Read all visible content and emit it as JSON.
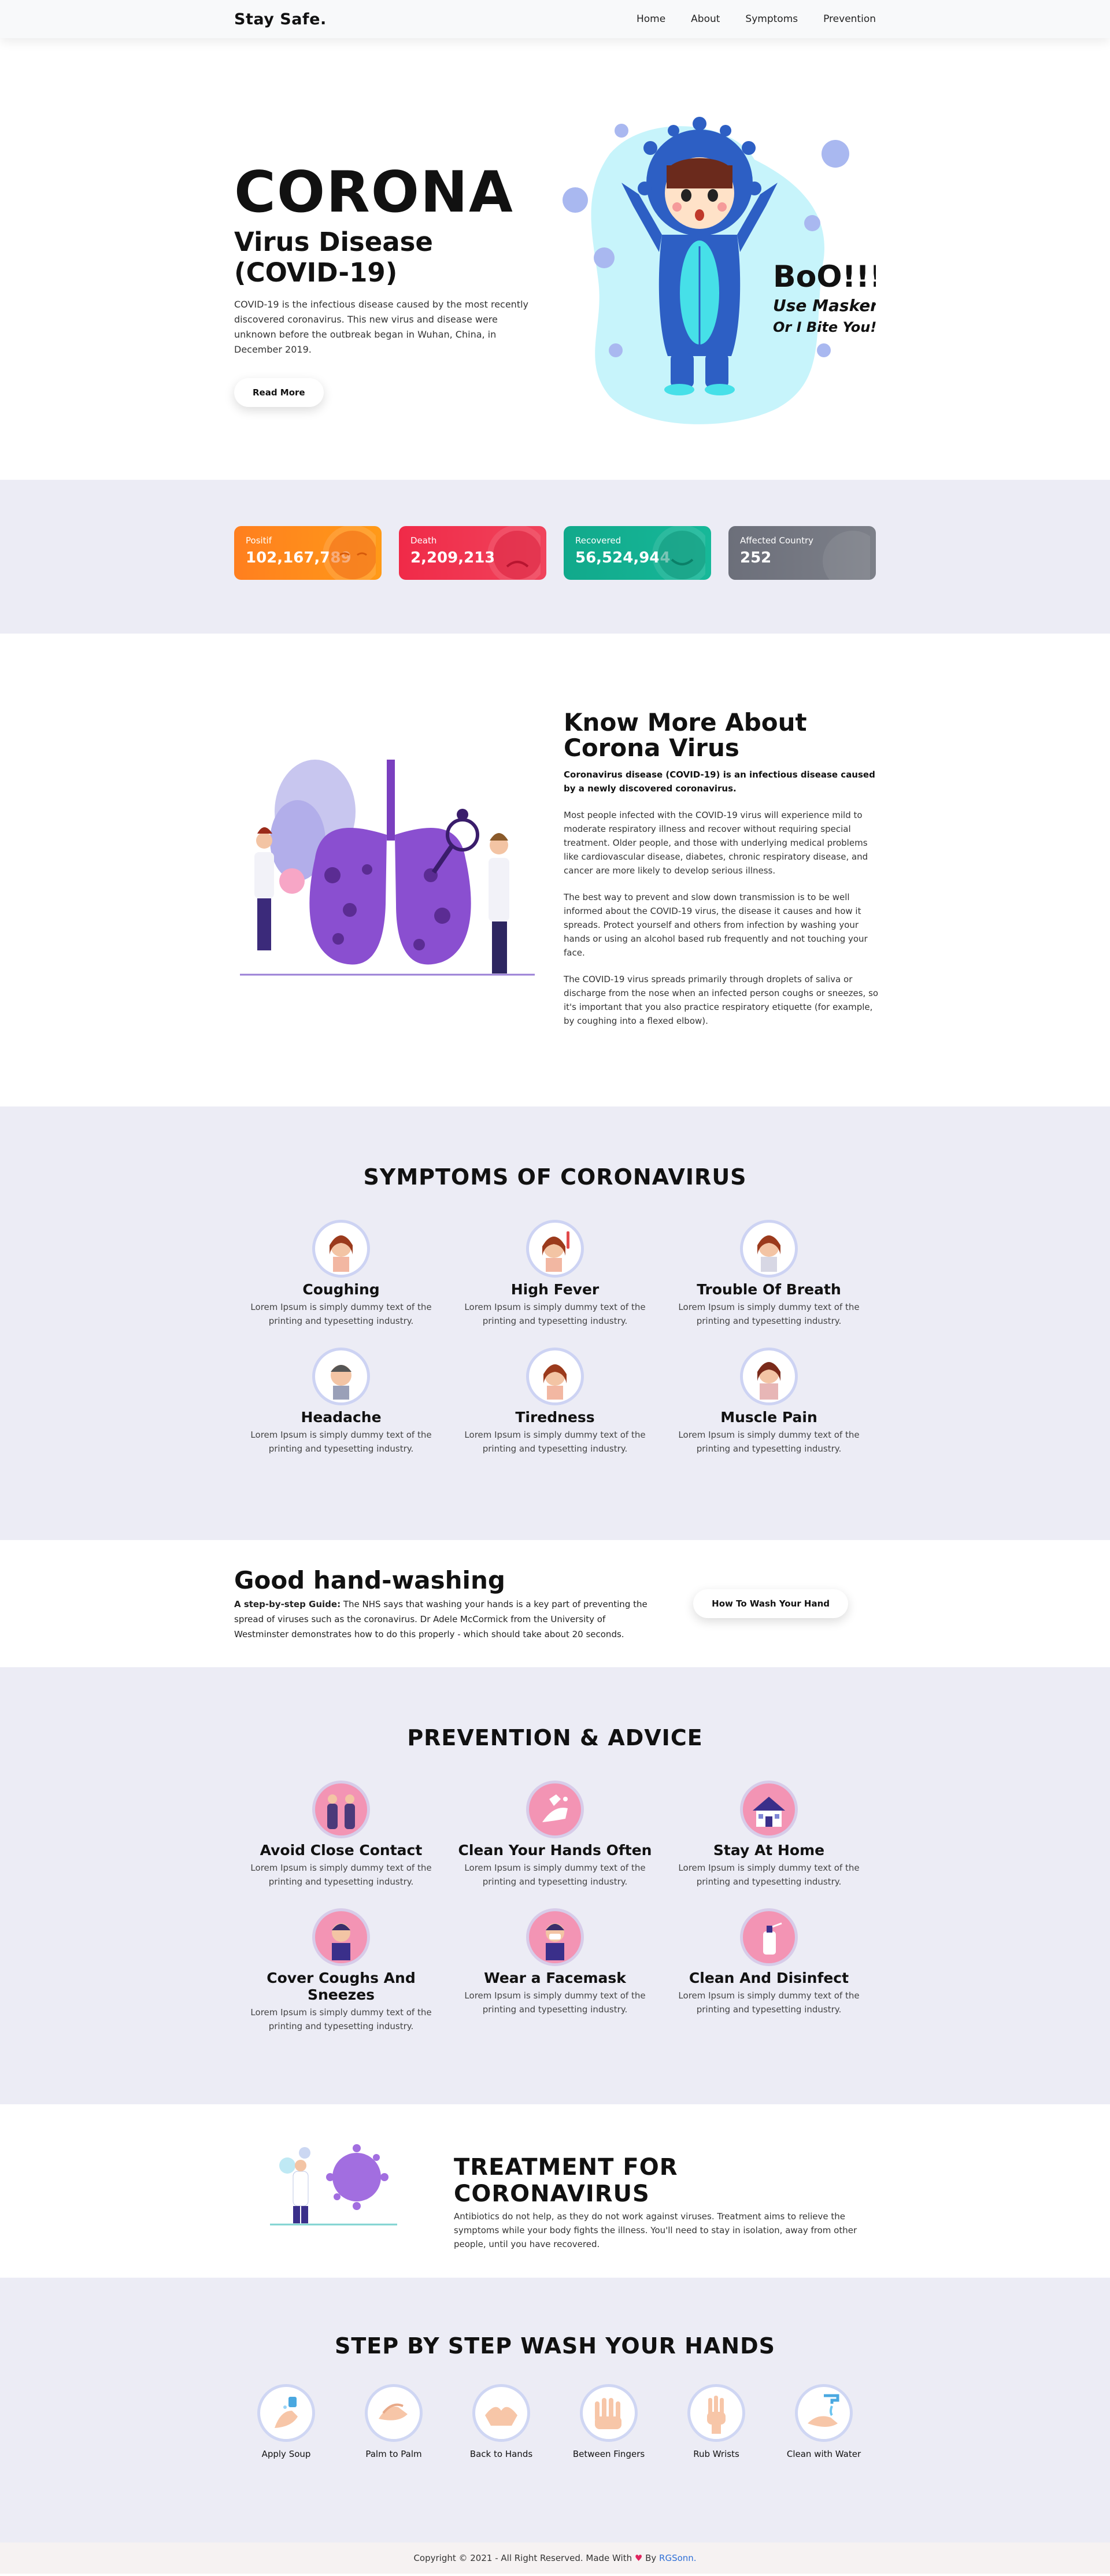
{
  "nav": {
    "brand": "Stay Safe.",
    "links": [
      "Home",
      "About",
      "Symptoms",
      "Prevention"
    ]
  },
  "hero": {
    "title": "CORONA",
    "subtitle": "Virus Disease (COVID-19)",
    "description": "COVID-19 is the infectious disease caused by the most recently discovered coronavirus. This new virus and disease were unknown before the outbreak began in Wuhan, China, in December 2019.",
    "button": "Read More",
    "art_text_1": "BoO!!!",
    "art_text_2": "Use Masker",
    "art_text_3": "Or I Bite You!"
  },
  "stats": [
    {
      "label": "Positif",
      "value": "102,167,789",
      "color": "#ff8a1c"
    },
    {
      "label": "Death",
      "value": "2,209,213",
      "color": "#f03550"
    },
    {
      "label": "Recovered",
      "value": "56,524,944",
      "color": "#14b090"
    },
    {
      "label": "Affected Country",
      "value": "252",
      "color": "#737681"
    }
  ],
  "about": {
    "title": "Know More About Corona Virus",
    "lead": "Coronavirus disease (COVID-19) is an infectious disease caused by a newly discovered coronavirus.",
    "p1": "Most people infected with the COVID-19 virus will experience mild to moderate respiratory illness and recover without requiring special treatment. Older people, and those with underlying medical problems like cardiovascular disease, diabetes, chronic respiratory disease, and cancer are more likely to develop serious illness.",
    "p2": "The best way to prevent and slow down transmission is to be well informed about the COVID-19 virus, the disease it causes and how it spreads. Protect yourself and others from infection by washing your hands or using an alcohol based rub frequently and not touching your face.",
    "p3": "The COVID-19 virus spreads primarily through droplets of saliva or discharge from the nose when an infected person coughs or sneezes, so it's important that you also practice respiratory etiquette (for example, by coughing into a flexed elbow)."
  },
  "symptoms": {
    "title": "SYMPTOMS OF CORONAVIRUS",
    "items": [
      {
        "title": "Coughing",
        "desc": "Lorem Ipsum is simply dummy text of the printing and typesetting industry."
      },
      {
        "title": "High Fever",
        "desc": "Lorem Ipsum is simply dummy text of the printing and typesetting industry."
      },
      {
        "title": "Trouble Of Breath",
        "desc": "Lorem Ipsum is simply dummy text of the printing and typesetting industry."
      },
      {
        "title": "Headache",
        "desc": "Lorem Ipsum is simply dummy text of the printing and typesetting industry."
      },
      {
        "title": "Tiredness",
        "desc": "Lorem Ipsum is simply dummy text of the printing and typesetting industry."
      },
      {
        "title": "Muscle Pain",
        "desc": "Lorem Ipsum is simply dummy text of the printing and typesetting industry."
      }
    ]
  },
  "handwash": {
    "title": "Good hand-washing",
    "guide_label": "A step-by-step Guide:",
    "guide_text": " The NHS says that washing your hands is a key part of preventing the spread of viruses such as the coronavirus. Dr Adele McCormick from the University of Westminster demonstrates how to do this properly - which should take about 20 seconds.",
    "button": "How To Wash Your Hand"
  },
  "prevention": {
    "title": "PREVENTION & ADVICE",
    "items": [
      {
        "title": "Avoid Close Contact",
        "desc": "Lorem Ipsum is simply dummy text of the printing and typesetting industry."
      },
      {
        "title": "Clean Your Hands Often",
        "desc": "Lorem Ipsum is simply dummy text of the printing and typesetting industry."
      },
      {
        "title": "Stay At Home",
        "desc": "Lorem Ipsum is simply dummy text of the printing and typesetting industry."
      },
      {
        "title": "Cover Coughs And Sneezes",
        "desc": "Lorem Ipsum is simply dummy text of the printing and typesetting industry."
      },
      {
        "title": "Wear a Facemask",
        "desc": "Lorem Ipsum is simply dummy text of the printing and typesetting industry."
      },
      {
        "title": "Clean And Disinfect",
        "desc": "Lorem Ipsum is simply dummy text of the printing and typesetting industry."
      }
    ]
  },
  "treatment": {
    "title": "TREATMENT FOR CORONAVIRUS",
    "desc": "Antibiotics do not help, as they do not work against viruses. Treatment aims to relieve the symptoms while your body fights the illness. You'll need to stay in isolation, away from other people, until you have recovered."
  },
  "steps": {
    "title": "STEP BY STEP WASH YOUR HANDS",
    "items": [
      "Apply Soup",
      "Palm to Palm",
      "Back to Hands",
      "Between Fingers",
      "Rub Wrists",
      "Clean with Water"
    ]
  },
  "footer": {
    "text": "Copyright © 2021 - All Right Reserved. Made With ",
    "heart": "♥",
    "by": " By ",
    "author": "RGSonn."
  }
}
